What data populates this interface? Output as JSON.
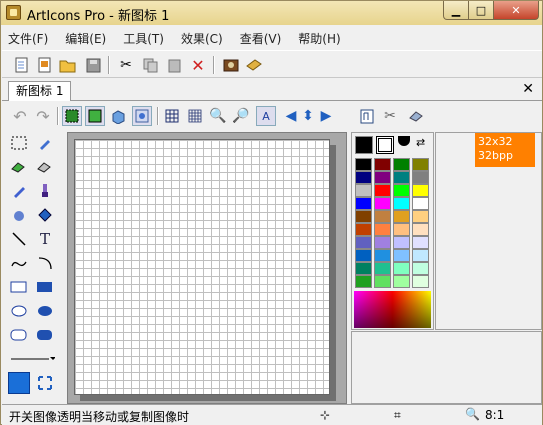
{
  "window": {
    "title": "ArtIcons Pro - 新图标 1"
  },
  "menu": [
    "文件(F)",
    "编辑(E)",
    "工具(T)",
    "效果(C)",
    "查看(V)",
    "帮助(H)"
  ],
  "tabs": {
    "active": "新图标 1"
  },
  "formats": {
    "selected": "32x32",
    "depth": "32bpp"
  },
  "status": {
    "hint": "开关图像透明当移动或复制图像时",
    "zoom": "8:1"
  },
  "palette": {
    "selected_colors": [
      "#000000",
      "#000000"
    ],
    "swatches": [
      [
        "#000000",
        "#800000",
        "#008000",
        "#808000"
      ],
      [
        "#000080",
        "#800080",
        "#008080",
        "#808080"
      ],
      [
        "#c0c0c0",
        "#ff0000",
        "#00ff00",
        "#ffff00"
      ],
      [
        "#0000ff",
        "#ff00ff",
        "#00ffff",
        "#ffffff"
      ],
      [
        "#804000",
        "#c08040",
        "#e0a020",
        "#ffd080"
      ],
      [
        "#c04000",
        "#ff8040",
        "#ffc080",
        "#ffe0c0"
      ],
      [
        "#6060c0",
        "#a080e0",
        "#c0c0ff",
        "#e0e0ff"
      ],
      [
        "#0060c0",
        "#2090e0",
        "#80c0ff",
        "#c0e8ff"
      ],
      [
        "#008060",
        "#20c090",
        "#80ffc0",
        "#c0ffe0"
      ],
      [
        "#20a020",
        "#60e060",
        "#a0ffa0",
        "#e0ffe0"
      ]
    ]
  }
}
